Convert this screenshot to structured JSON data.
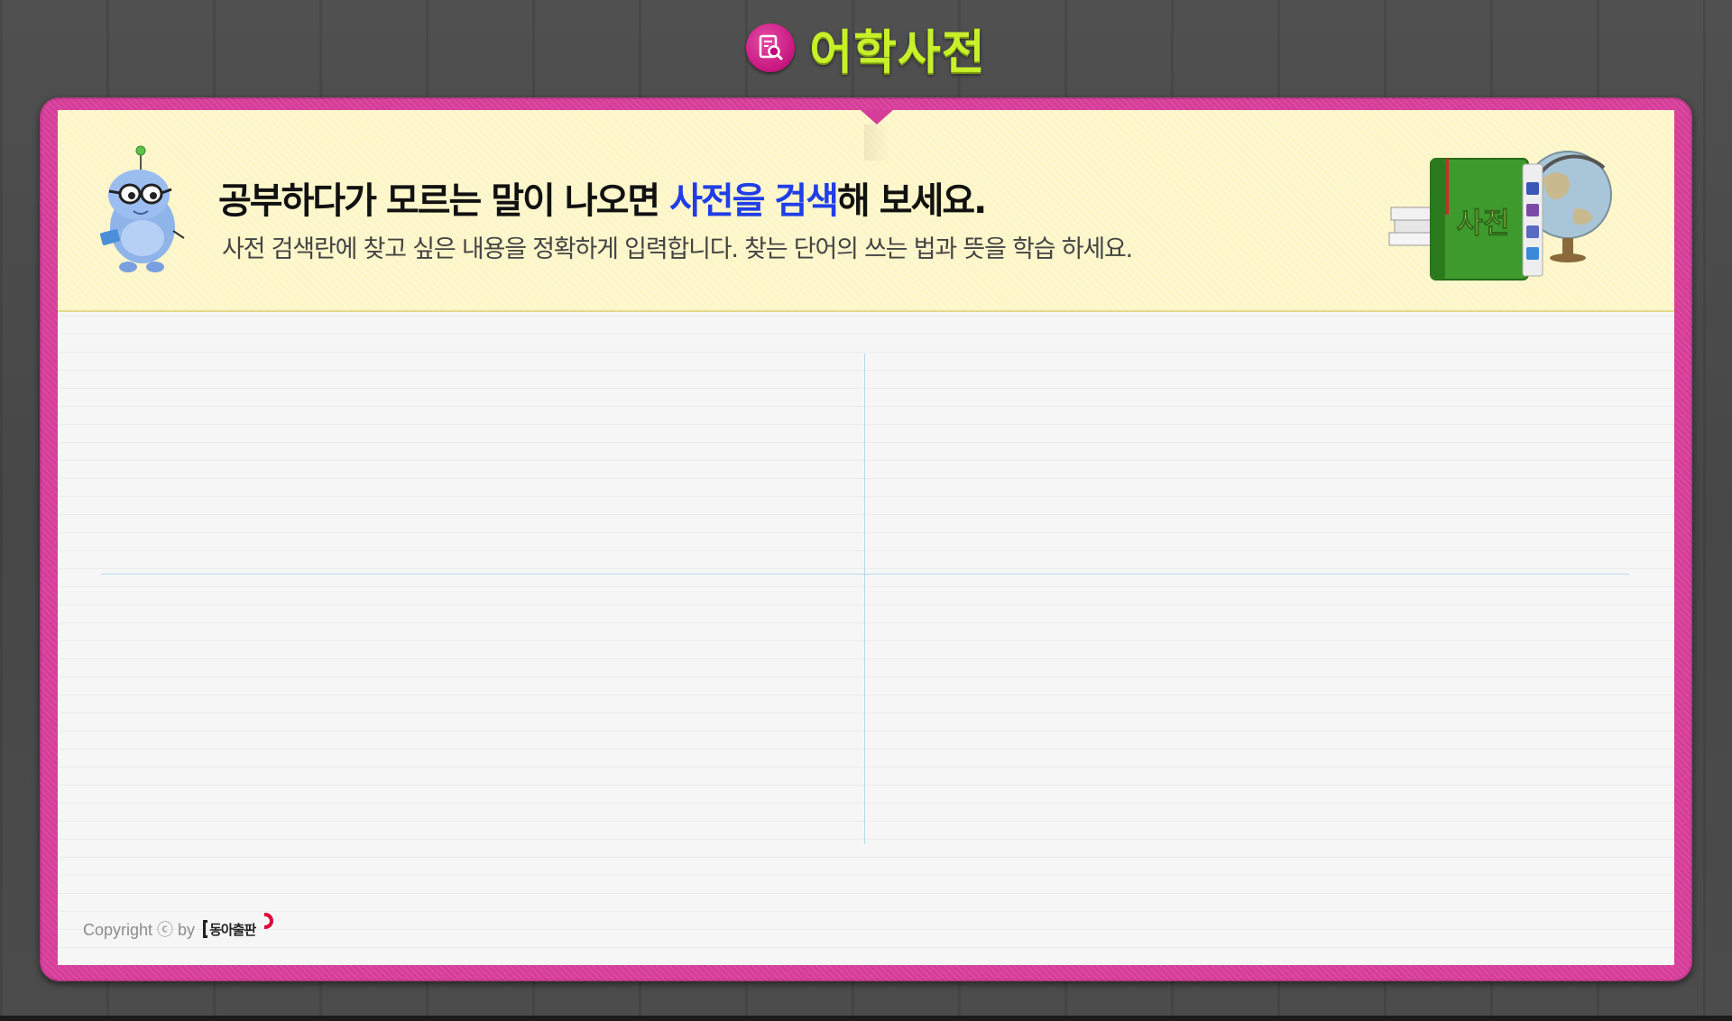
{
  "header": {
    "title": "어학사전",
    "title_color": "#c7f02a",
    "icon": "dictionary-search-icon"
  },
  "banner": {
    "headline_pre": "공부하다가 모르는 말이 나오면 ",
    "headline_highlight": "사전을 검색",
    "headline_post": "해 보세요.",
    "subline": "사전 검색란에 찾고 싶은 내용을 정확하게 입력합니다. 찾는 단어의 쓰는 법과 뜻을 학습 하세요.",
    "highlight_color": "#1f3ee6",
    "mascot": "robot-mascot-with-glasses",
    "book_label": "사전"
  },
  "footer": {
    "copyright": "Copyright ⓒ by",
    "brand": "동아출판"
  },
  "colors": {
    "frame": "#d63c99",
    "banner_bg": "#fcf5c4",
    "divider": "#b4d9ee",
    "background": "#4a4a4a"
  }
}
